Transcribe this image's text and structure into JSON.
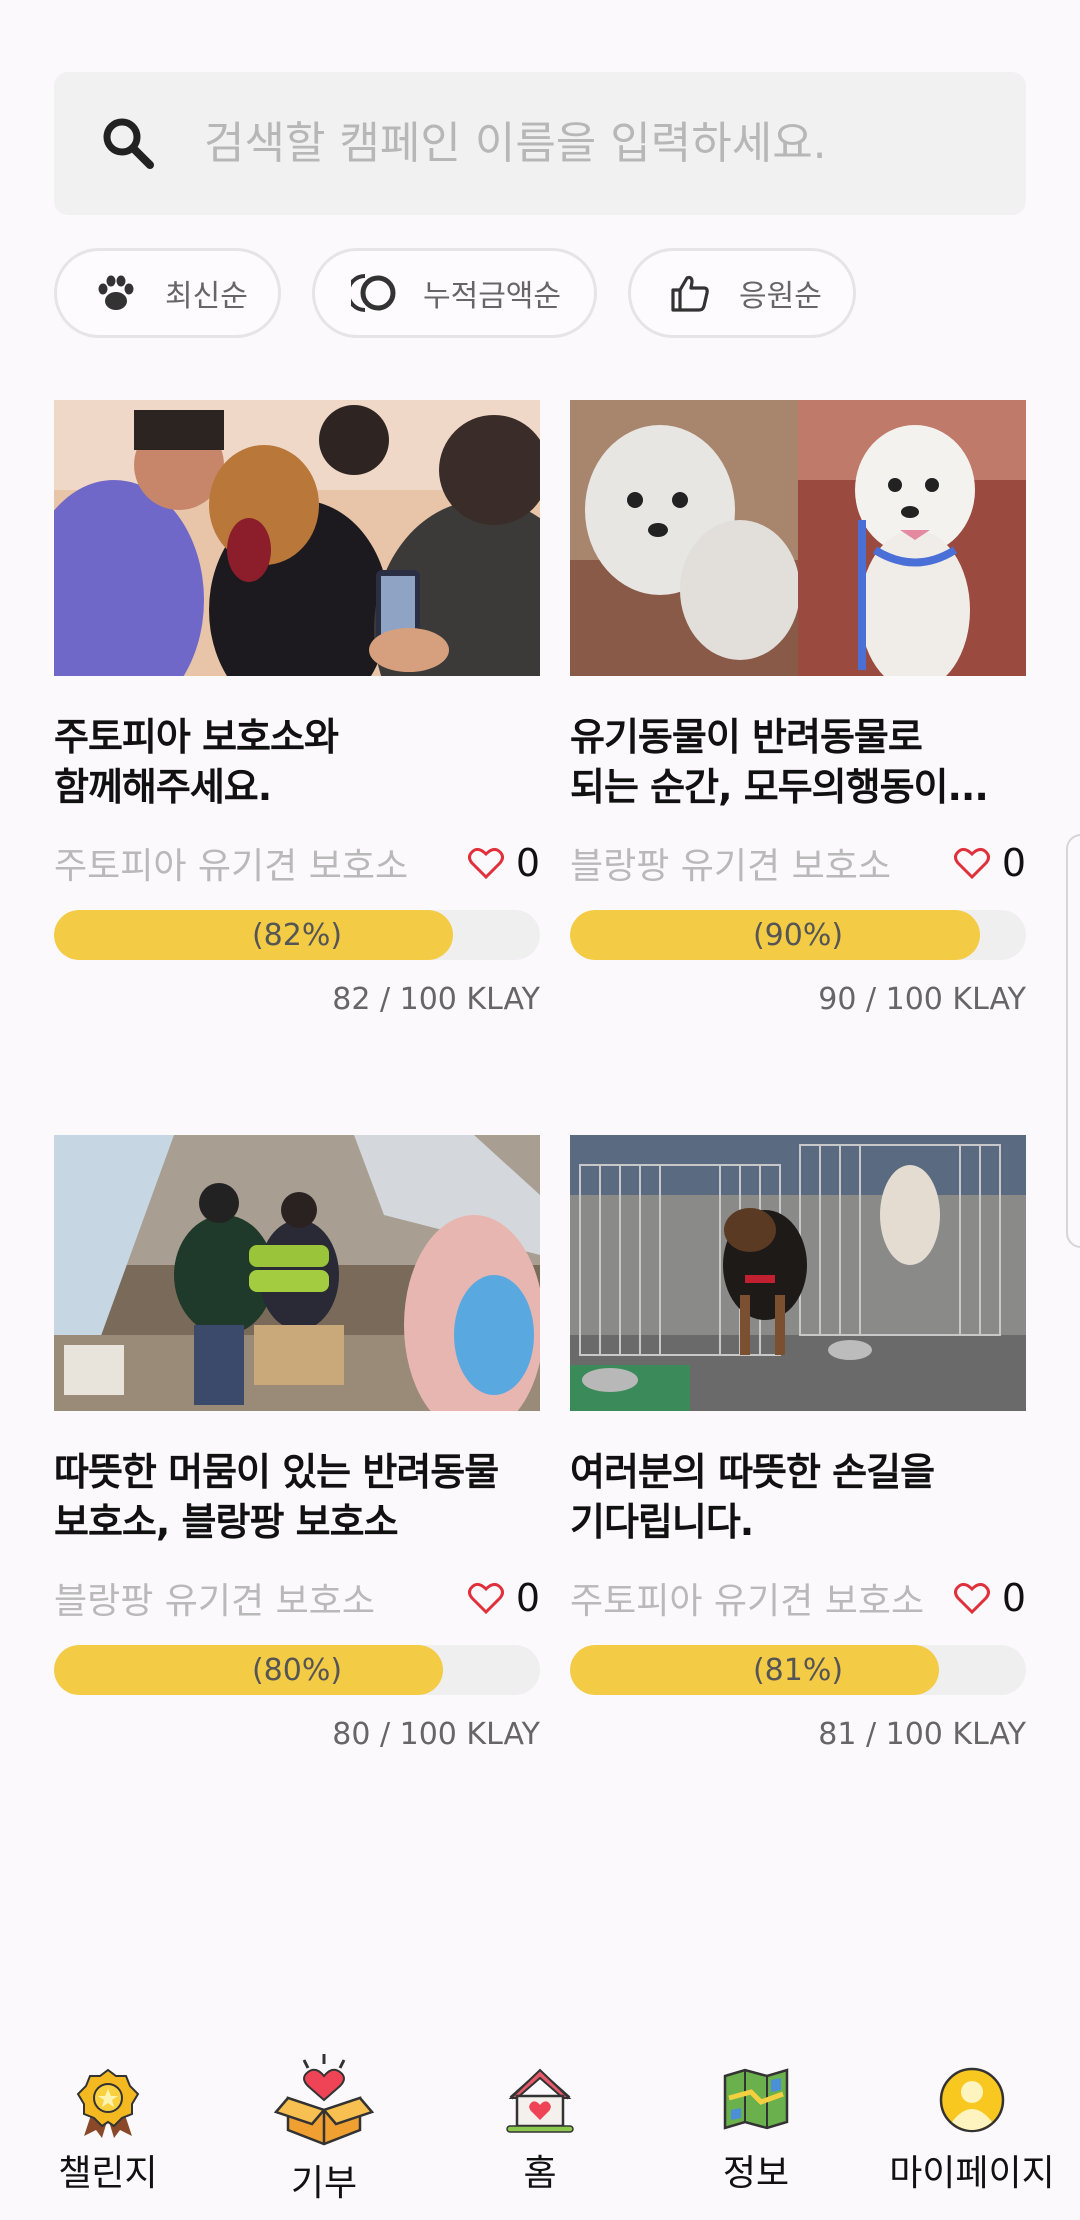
{
  "search": {
    "placeholder": "검색할 캠페인 이름을 입력하세요."
  },
  "sort_chips": [
    {
      "label": "최신순",
      "icon": "paw-icon"
    },
    {
      "label": "누적금액순",
      "icon": "coins-icon"
    },
    {
      "label": "응원순",
      "icon": "thumbs-up-icon"
    }
  ],
  "campaigns": [
    {
      "title": "주토피아 보호소와\n함께해주세요.",
      "shelter": "주토피아 유기견 보호소",
      "likes": "0",
      "percent_label": "(82%)",
      "progress": 0.82,
      "amount": "82 / 100 KLAY"
    },
    {
      "title": "유기동물이 반려동물로\n되는 순간, 모두의행동이...",
      "shelter": "블랑팡 유기견 보호소",
      "likes": "0",
      "percent_label": "(90%)",
      "progress": 0.9,
      "amount": "90 / 100 KLAY"
    },
    {
      "title": "따뜻한 머뭄이 있는 반려동물\n보호소, 블랑팡 보호소",
      "shelter": "블랑팡 유기견 보호소",
      "likes": "0",
      "percent_label": "(80%)",
      "progress": 0.8,
      "amount": "80 / 100 KLAY"
    },
    {
      "title": "여러분의 따뜻한 손길을\n기다립니다.",
      "shelter": "주토피아 유기견 보호소",
      "likes": "0",
      "percent_label": "(81%)",
      "progress": 0.81,
      "amount": "81 / 100 KLAY"
    }
  ],
  "nav": [
    {
      "label": "챌린지",
      "icon": "medal-icon"
    },
    {
      "label": "기부",
      "icon": "donation-box-icon",
      "active": true
    },
    {
      "label": "홈",
      "icon": "house-heart-icon"
    },
    {
      "label": "정보",
      "icon": "map-icon"
    },
    {
      "label": "마이페이지",
      "icon": "user-avatar-icon"
    }
  ],
  "colors": {
    "accent": "#f4cb45",
    "background": "#fcf9fc",
    "heart": "#e0303b"
  }
}
